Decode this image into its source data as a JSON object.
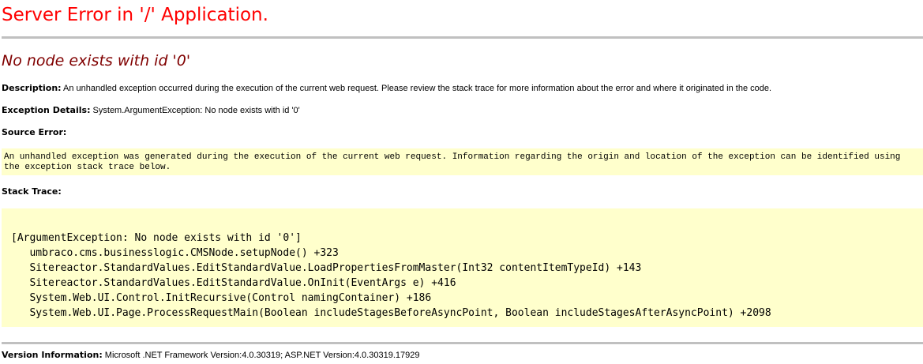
{
  "header": {
    "title": "Server Error in '/' Application.",
    "error_message": "No node exists with id '0'"
  },
  "description": {
    "label": "Description:",
    "text": "An unhandled exception occurred during the execution of the current web request. Please review the stack trace for more information about the error and where it originated in the code."
  },
  "exception_details": {
    "label": "Exception Details:",
    "text": "System.ArgumentException: No node exists with id '0'"
  },
  "source_error": {
    "label": "Source Error:",
    "lines": [
      "An unhandled exception was generated during the execution of the current web request. Information regarding the origin and location of the exception can be identified using",
      "the exception stack trace below."
    ]
  },
  "stack_trace": {
    "label": "Stack Trace:",
    "lines": [
      "[ArgumentException: No node exists with id '0']",
      "   umbraco.cms.businesslogic.CMSNode.setupNode() +323",
      "   Sitereactor.StandardValues.EditStandardValue.LoadPropertiesFromMaster(Int32 contentItemTypeId) +143",
      "   Sitereactor.StandardValues.EditStandardValue.OnInit(EventArgs e) +416",
      "   System.Web.UI.Control.InitRecursive(Control namingContainer) +186",
      "   System.Web.UI.Page.ProcessRequestMain(Boolean includeStagesBeforeAsyncPoint, Boolean includeStagesAfterAsyncPoint) +2098"
    ]
  },
  "version_information": {
    "label": "Version Information:",
    "text": "Microsoft .NET Framework Version:4.0.30319; ASP.NET Version:4.0.30319.17929"
  },
  "colors": {
    "title": "#ff0000",
    "error_message": "#800000",
    "code_background": "#ffffcc",
    "rule": "#c0c0c0"
  }
}
